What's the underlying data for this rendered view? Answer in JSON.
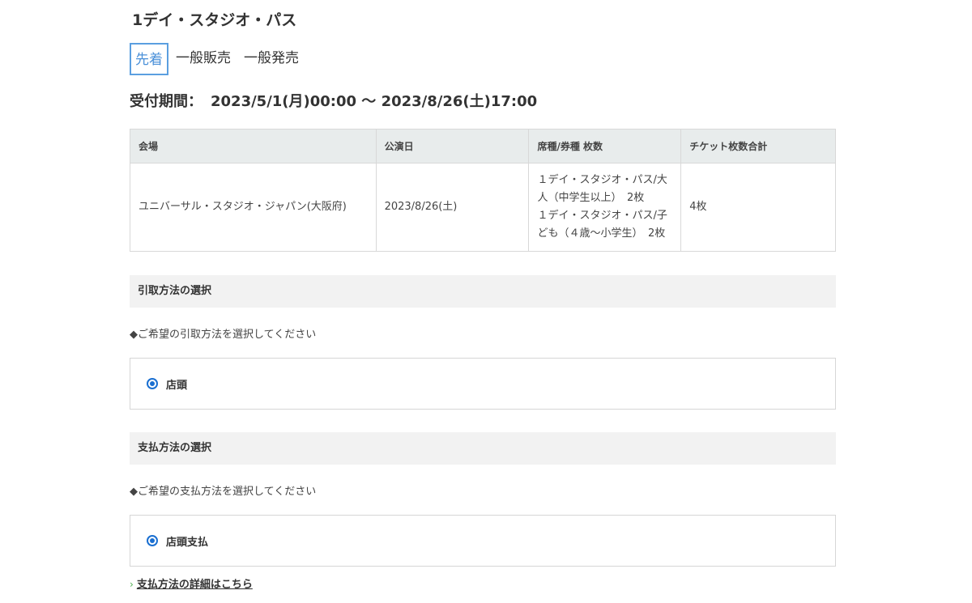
{
  "product": {
    "title": "1デイ・スタジオ・パス"
  },
  "tabs": [
    {
      "label": "先着",
      "active": true
    },
    {
      "label": "一般販売",
      "active": false
    },
    {
      "label": "一般発売",
      "active": false
    }
  ],
  "period": {
    "label": "受付期間：",
    "value": "2023/5/1(月)00:00 ～ 2023/8/26(土)17:00"
  },
  "order_table": {
    "headers": [
      "会場",
      "公演日",
      "席種/券種 枚数",
      "チケット枚数合計"
    ],
    "row": {
      "venue": "ユニバーサル・スタジオ・ジャパン(大阪府)",
      "date": "2023/8/26(土)",
      "ticket_types": [
        "１デイ・スタジオ・パス/大人（中学生以上）　2枚",
        "１デイ・スタジオ・パス/子ども（４歳～小学生）　2枚"
      ],
      "total": "4枚"
    }
  },
  "pickup": {
    "heading": "引取方法の選択",
    "instruction": "◆ご希望の引取方法を選択してください",
    "option": "店頭",
    "selected": true
  },
  "payment": {
    "heading": "支払方法の選択",
    "instruction": "◆ご希望の支払方法を選択してください",
    "option": "店頭支払",
    "selected": true,
    "detail_link": "支払方法の詳細はこちら"
  },
  "colors": {
    "accent": "#4a90d9",
    "radio": "#1a6fd1",
    "header_bg": "#e8ecec",
    "section_bg": "#f2f2f2",
    "link_chevron": "#4caf50"
  }
}
